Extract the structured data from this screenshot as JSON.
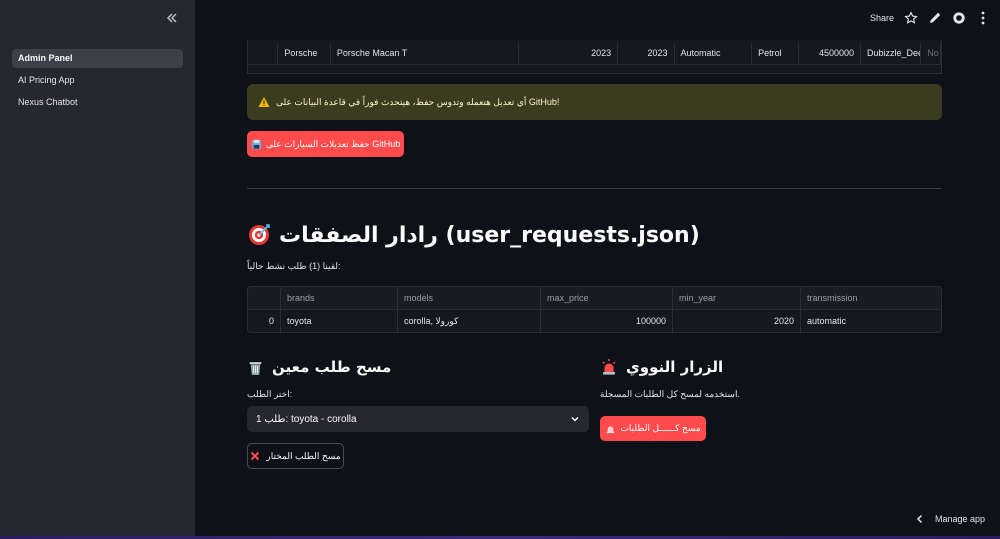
{
  "sidebar": {
    "items": [
      {
        "label": "Admin Panel",
        "active": true
      },
      {
        "label": "AI Pricing App",
        "active": false
      },
      {
        "label": "Nexus Chatbot",
        "active": false
      }
    ]
  },
  "header": {
    "share_label": "Share"
  },
  "top_table": {
    "row": [
      "Porsche",
      "Porsche Macan T",
      "2023",
      "2023",
      "Automatic",
      "Petrol",
      "4500000",
      "Dubizzle_Deep",
      "No"
    ]
  },
  "warning": {
    "text": "أي تعديل هتعمله وتدوس حفظ، هيتحدث فوراً في قاعدة البيانات على GitHub!",
    "icon": "warning-icon",
    "color": "#3a3b1f"
  },
  "save_button": {
    "label": "حفظ تعديلات السيارات على GitHub",
    "icon": "floppy-disk-icon"
  },
  "radar": {
    "title": "رادار الصفقات (user_requests.json)",
    "icon": "target-icon",
    "caption": "لقينا (1) طلب نشط حالياً:"
  },
  "requests_table": {
    "columns": [
      "",
      "brands",
      "models",
      "max_price",
      "min_year",
      "transmission"
    ],
    "rows": [
      [
        "0",
        "toyota",
        "corolla, كورولا",
        "100000",
        "2020",
        "automatic"
      ]
    ]
  },
  "clear_single": {
    "title": "مسح طلب معين",
    "icon": "wastebasket-icon",
    "select_label": "اختر الطلب:",
    "select_value": "طلب 1: toyota - corolla",
    "button_label": "مسح الطلب المختار",
    "button_icon": "cross-mark-icon"
  },
  "nuclear": {
    "title": "الزرار النووي",
    "icon": "siren-icon",
    "description": "استخدمه لمسح كل الطلبات المسجلة.",
    "button_label": "مسح كــــــل الطلبات",
    "button_icon": "siren-icon"
  },
  "footer": {
    "manage_label": "Manage app"
  },
  "colors": {
    "background": "#0e1117",
    "sidebar": "#262730",
    "primary": "#ff4b4b"
  }
}
